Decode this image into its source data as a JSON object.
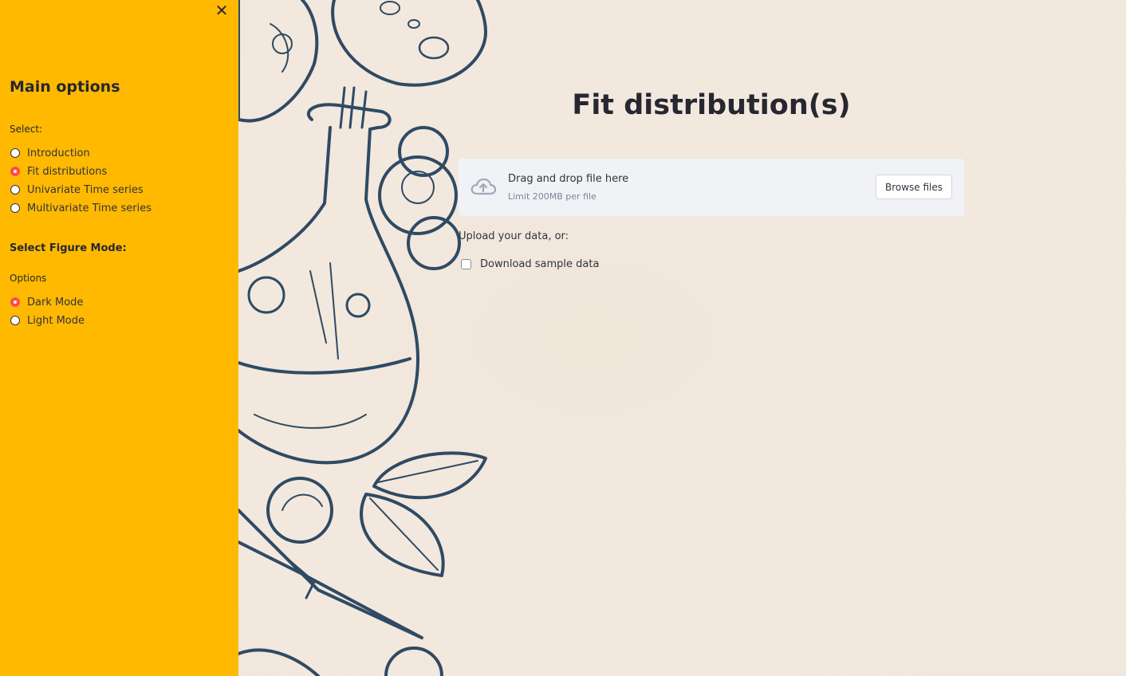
{
  "sidebar": {
    "close_symbol": "✕",
    "title": "Main options",
    "select_label": "Select:",
    "pages": [
      {
        "label": "Introduction",
        "selected": false
      },
      {
        "label": "Fit distributions",
        "selected": true
      },
      {
        "label": "Univariate Time series",
        "selected": false
      },
      {
        "label": "Multivariate Time series",
        "selected": false
      }
    ],
    "figure_mode_heading": "Select Figure Mode:",
    "options_label": "Options",
    "modes": [
      {
        "label": "Dark Mode",
        "selected": true
      },
      {
        "label": "Light Mode",
        "selected": false
      }
    ]
  },
  "main": {
    "title": "Fit distribution(s)",
    "uploader": {
      "icon": "cloud-upload-icon",
      "drop_text": "Drag and drop file here",
      "limit_text": "Limit 200MB per file",
      "browse_label": "Browse files"
    },
    "upload_label": "Upload your data, or:",
    "sample_checkbox": {
      "label": "Download sample data",
      "checked": false
    }
  },
  "colors": {
    "sidebar_bg": "#ffb900",
    "accent": "#ff4b4b",
    "main_bg": "#f1e7dc",
    "text": "#31333f",
    "uploader_bg": "#f0f2f6",
    "illustration_stroke": "#2f4a63"
  }
}
